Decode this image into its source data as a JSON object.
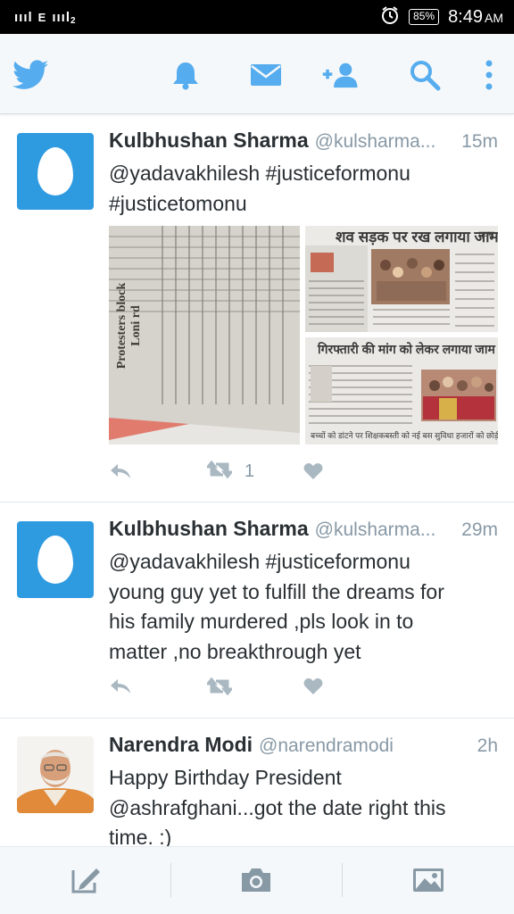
{
  "status_bar": {
    "signal_text": "ıııl",
    "network_type": "E",
    "signal_text_2": "ıııl",
    "sim_index": "2",
    "battery": "85%",
    "time": "8:49",
    "am_pm": "AM"
  },
  "toolbar": {
    "icons": [
      "twitter-bird-icon",
      "notifications-bell-icon",
      "messages-envelope-icon",
      "add-user-icon",
      "search-icon",
      "more-options-icon"
    ],
    "accent_color": "#55acee"
  },
  "tweets": [
    {
      "name": "Kulbhushan Sharma",
      "handle": "@kulsharma...",
      "time": "15m",
      "text": "@yadavakhilesh #justiceformonu\n#justicetomonu",
      "retweet_count": "1",
      "media": {
        "left_caption": "Protesters block Loni rd",
        "top_right_headline": "शव सड़क पर रख लगाया जाम",
        "top_right_side": "एक्स",
        "bottom_right_headline": "गिरफ्तारी की मांग को लेकर लगाया जाम",
        "bottom_right_footer_1": "बच्चों को डांटने पर शिक्षक",
        "bottom_right_footer_2": "बस्ती को नई बस सुविधा हजारों को छोड़ी"
      }
    },
    {
      "name": "Kulbhushan Sharma",
      "handle": "@kulsharma...",
      "time": "29m",
      "text": "@yadavakhilesh #justiceformonu\nyoung guy yet to fulfill the dreams for\nhis family murdered ,pls look in to\nmatter ,no breakthrough yet"
    },
    {
      "name": "Narendra Modi",
      "handle": "@narendramodi",
      "time": "2h",
      "text": "Happy Birthday President\n@ashrafghani...got the date right this\ntime. :)"
    }
  ],
  "bottom_bar": {
    "buttons": [
      "compose-tweet-icon",
      "camera-icon",
      "photo-gallery-icon"
    ]
  }
}
